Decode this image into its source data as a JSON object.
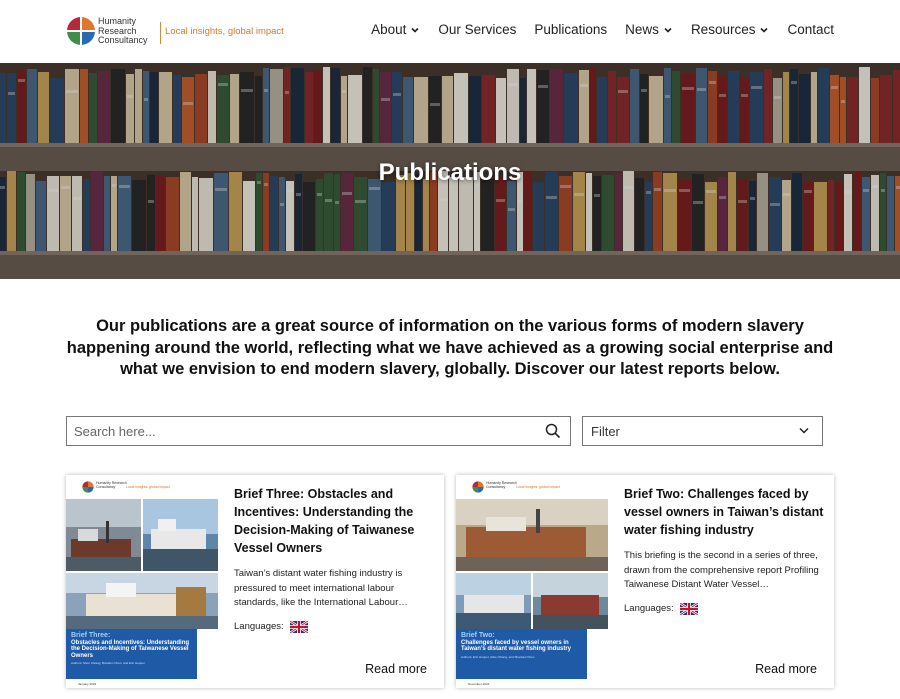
{
  "header": {
    "logo_name_line1": "Humanity",
    "logo_name_line2": "Research",
    "logo_name_line3": "Consultancy",
    "logo_tagline": "Local insights, global impact",
    "nav": [
      {
        "label": "About",
        "has_dropdown": true
      },
      {
        "label": "Our Services",
        "has_dropdown": false
      },
      {
        "label": "Publications",
        "has_dropdown": false
      },
      {
        "label": "News",
        "has_dropdown": true
      },
      {
        "label": "Resources",
        "has_dropdown": true
      },
      {
        "label": "Contact",
        "has_dropdown": false
      }
    ]
  },
  "hero": {
    "title": "Publications"
  },
  "intro": {
    "text": "Our publications are a great source of information on the various forms of modern slavery happening around the world, reflecting what we have achieved as a growing social enterprise and what we envision to end modern slavery, globally. Discover our latest reports below."
  },
  "search": {
    "placeholder": "Search here..."
  },
  "filter": {
    "label": "Filter"
  },
  "colors": {
    "accent_orange": "#d07a2a",
    "cover_blue": "#1f5aa6"
  },
  "cards": [
    {
      "title": "Brief Three: Obstacles and Incentives: Understanding the Decision-Making of Taiwanese Vessel Owners",
      "excerpt": "Taiwan’s distant water fishing industry is pressured to meet international labour standards, like the International Labour…",
      "languages_label": "Languages:",
      "language_icon": "uk-flag-icon",
      "read_more": "Read more",
      "cover": {
        "logo_text": "Humanity Research Consultancy",
        "tagline": "Local insights, global impact",
        "box_title": "Brief Three:",
        "box_subtitle": "Obstacles and Incentives: Understanding the Decision-Making of Taiwanese Vessel Owners",
        "box_authors": "Authors: Shun Chiang, Brandon Chen, and Eric Hooper",
        "date": "January 2023"
      }
    },
    {
      "title": "Brief Two: Challenges faced by vessel owners in Taiwan’s distant water fishing industry",
      "excerpt": "This briefing is the second in a series of three, drawn from the comprehensive report Profiling Taiwanese Distant Water Vessel…",
      "languages_label": "Languages:",
      "language_icon": "uk-flag-icon",
      "read_more": "Read more",
      "cover": {
        "logo_text": "Humanity Research Consultancy",
        "tagline": "Local insights, global impact",
        "box_title": "Brief Two:",
        "box_subtitle": "Challenges faced by vessel owners in Taiwan’s distant water fishing industry",
        "box_authors": "Authors: Eric Hooper, Alice Chiang, and Shantani Chen",
        "date": "November 2022"
      }
    }
  ]
}
